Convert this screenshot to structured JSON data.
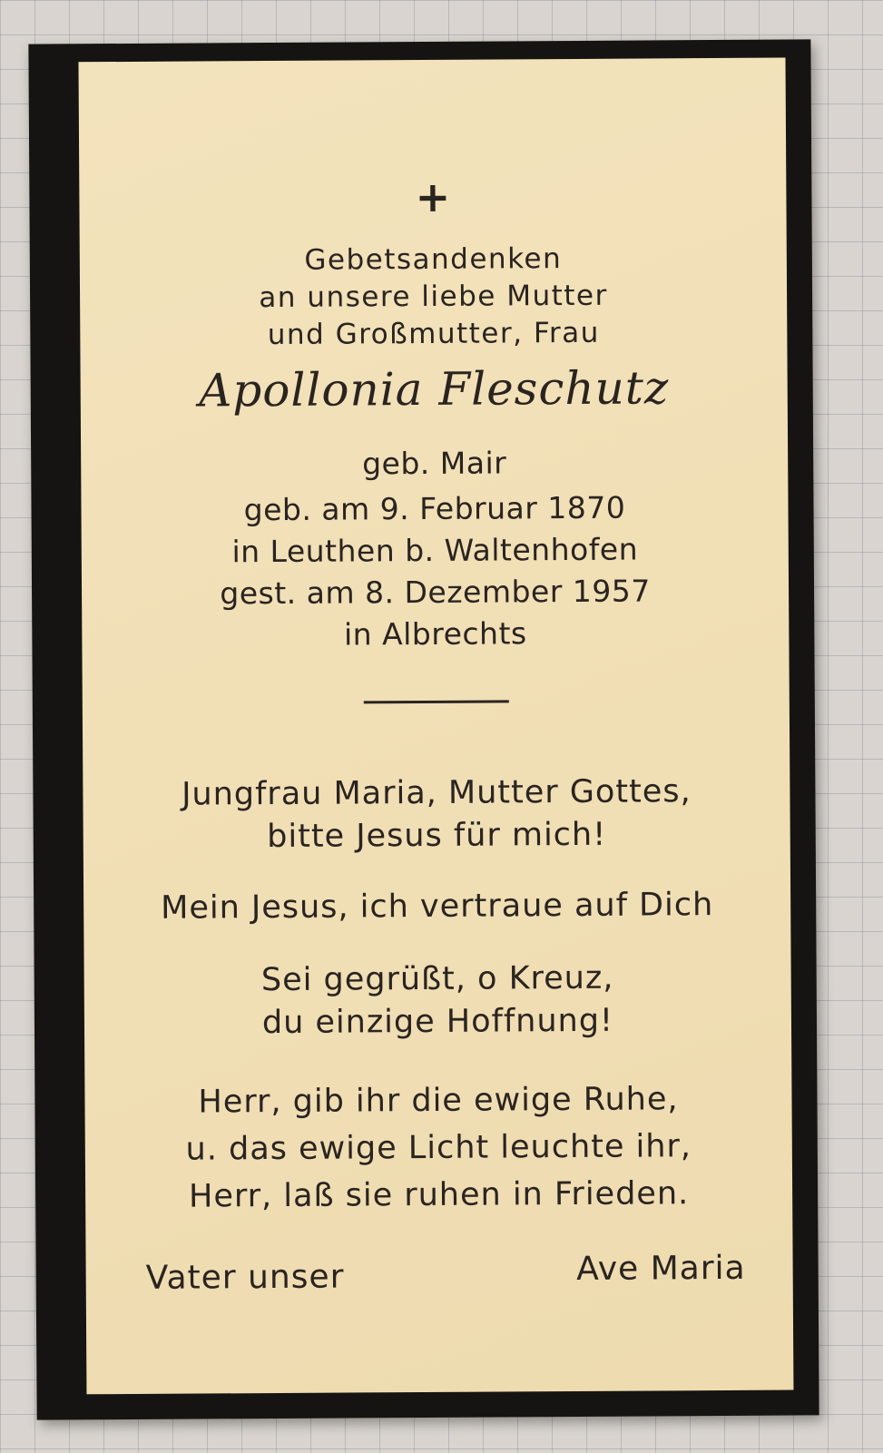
{
  "card": {
    "cross": "+",
    "intro": [
      "Gebetsandenken",
      "an unsere liebe Mutter",
      "und Großmutter, Frau"
    ],
    "name": "Apollonia Fleschutz",
    "maiden_name": "geb. Mair",
    "dates": [
      "geb. am 9. Februar 1870",
      "in Leuthen b. Waltenhofen",
      "gest. am 8. Dezember 1957",
      "in Albrechts"
    ],
    "prayers": [
      "Jungfrau Maria, Mutter Gottes,",
      "bitte Jesus für mich!",
      "Mein Jesus, ich vertraue auf Dich",
      "Sei gegrüßt, o Kreuz,",
      "du einzige Hoffnung!",
      "Herr, gib ihr die ewige Ruhe,",
      "u. das ewige Licht leuchte ihr,",
      "Herr, laß sie ruhen in Frieden."
    ],
    "closing_left": "Vater unser",
    "closing_right": "Ave Maria"
  }
}
